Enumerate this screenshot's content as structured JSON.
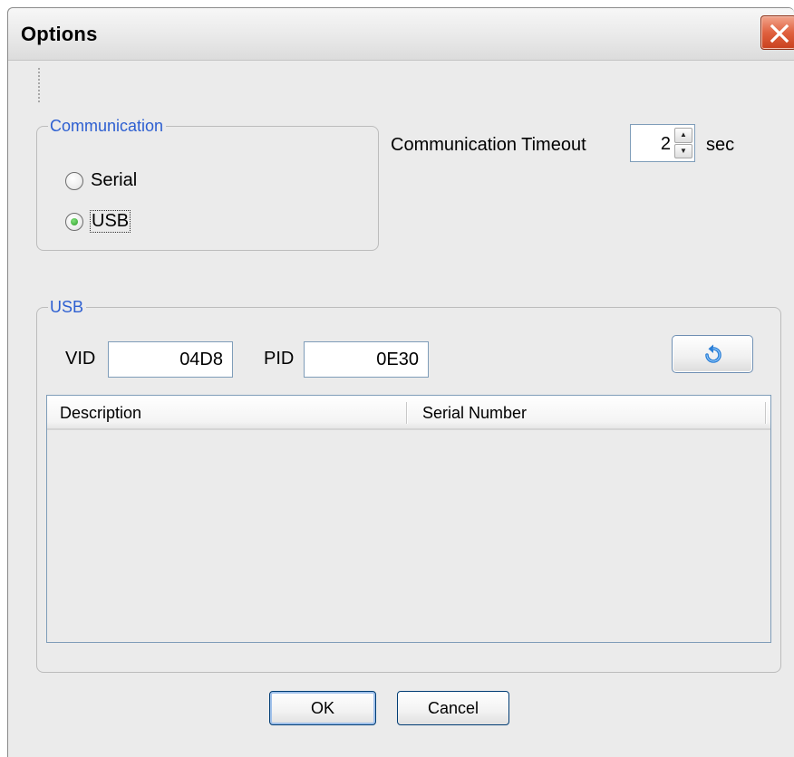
{
  "window": {
    "title": "Options"
  },
  "communication": {
    "group_label": "Communication",
    "options": [
      {
        "label": "Serial",
        "checked": false
      },
      {
        "label": "USB",
        "checked": true
      }
    ]
  },
  "timeout": {
    "label": "Communication Timeout",
    "value": "2",
    "unit": "sec"
  },
  "usb": {
    "group_label": "USB",
    "vid_label": "VID",
    "vid_value": "04D8",
    "pid_label": "PID",
    "pid_value": "0E30",
    "refresh_icon": "refresh-icon",
    "device_list": {
      "columns": [
        "Description",
        "Serial Number"
      ],
      "rows": []
    }
  },
  "buttons": {
    "ok": "OK",
    "cancel": "Cancel"
  },
  "colors": {
    "group_label": "#2d5fd1",
    "close_button": "#e0613f",
    "selected_radio": "#2f9e2a"
  }
}
